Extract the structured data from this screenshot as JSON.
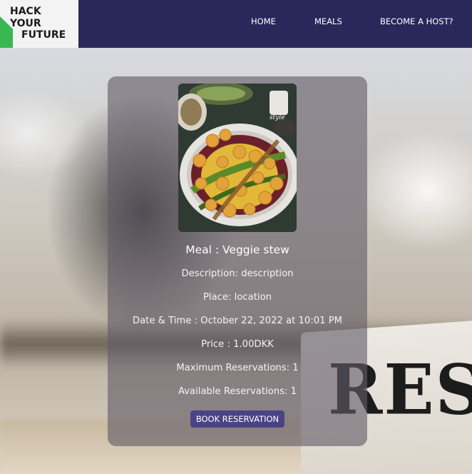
{
  "brand": {
    "logo_lines": [
      "HACK",
      "YOUR",
      "FUTURE"
    ]
  },
  "nav": {
    "items": [
      {
        "label": "HOME"
      },
      {
        "label": "MEALS"
      },
      {
        "label": "BECOME A HOST?"
      }
    ]
  },
  "background": {
    "sign_text": "RESE"
  },
  "meal": {
    "image_caption": "style",
    "title": "Meal : Veggie stew",
    "description": "Description: description",
    "place": "Place: location",
    "date_time": "Date & Time : October 22, 2022 at 10:01 PM",
    "price": "Price : 1.00DKK",
    "max_reservations": "Maximum Reservations: 1",
    "available_reservations": "Available Reservations: 1",
    "book_button": "BOOK RESERVATION"
  },
  "colors": {
    "navbar": "#2a275a",
    "card": "#625c68",
    "button": "#4a4485",
    "logo_accent": "#2fb24a"
  }
}
